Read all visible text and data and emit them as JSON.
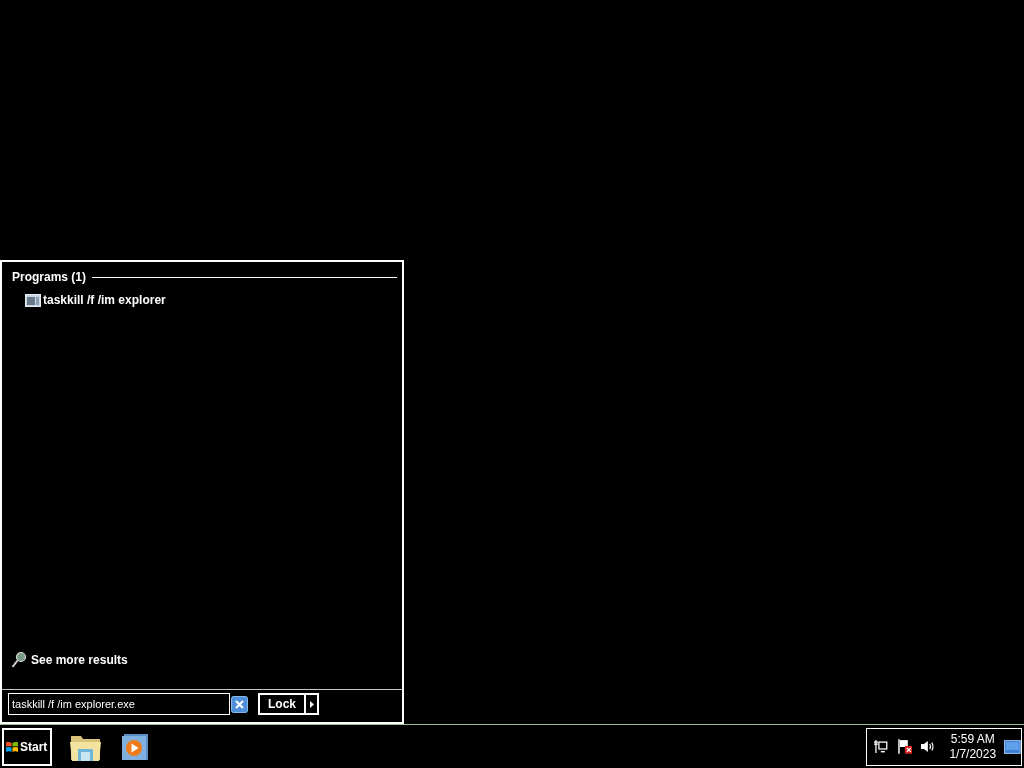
{
  "start_menu": {
    "section": {
      "heading": "Programs (1)",
      "items": [
        {
          "label": "taskkill /f /im explorer"
        }
      ]
    },
    "see_more": "See more results",
    "search": {
      "value": "taskkill /f /im explorer.exe"
    },
    "power_button": "Lock"
  },
  "taskbar": {
    "start_button": "Start",
    "clock": {
      "time": "5:59 AM",
      "date": "1/7/2023"
    }
  }
}
